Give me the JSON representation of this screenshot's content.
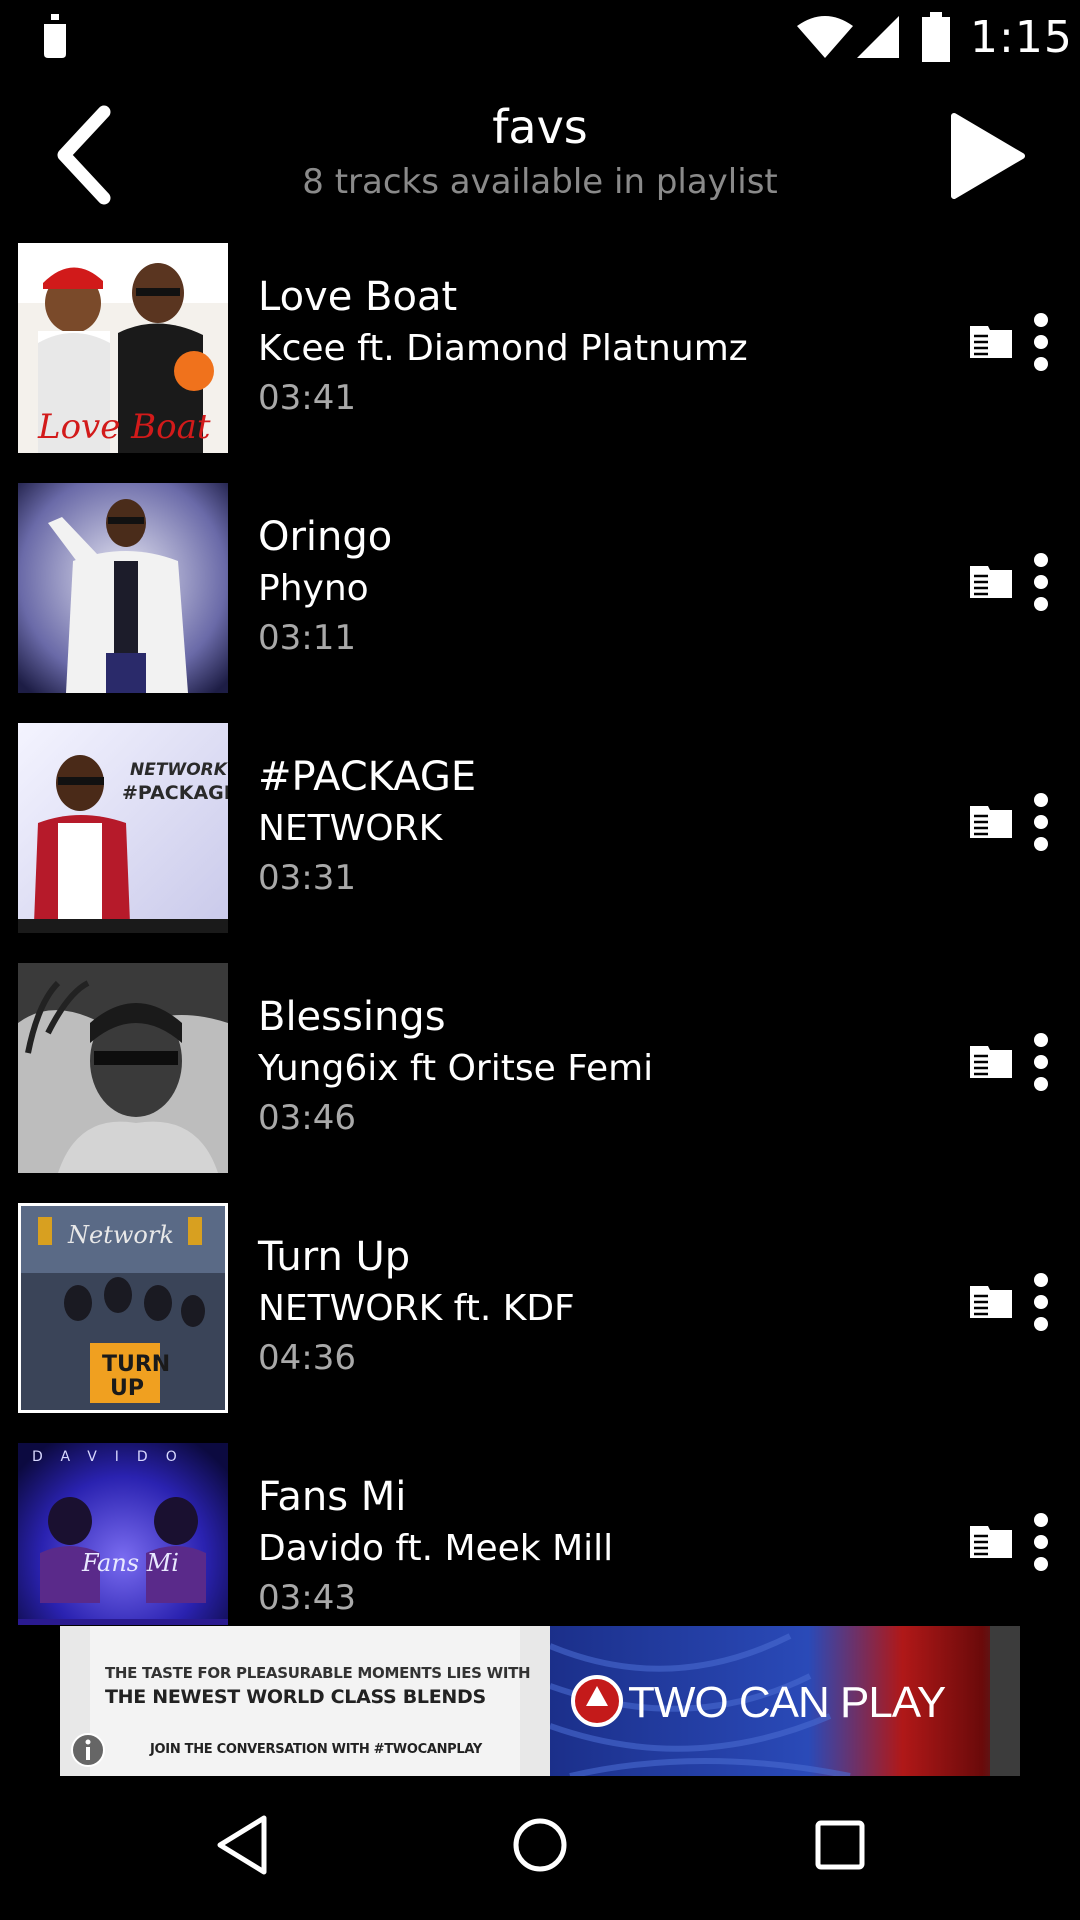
{
  "status_bar": {
    "time": "1:15",
    "icons": [
      "notification-icon",
      "wifi-icon",
      "signal-icon",
      "battery-icon"
    ]
  },
  "header": {
    "title": "favs",
    "subtitle": "8 tracks available in playlist",
    "back_icon": "chevron-left-icon",
    "play_icon": "play-icon"
  },
  "tracks": [
    {
      "title": "Love Boat",
      "artist": "Kcee ft. Diamond Platnumz",
      "duration": "03:41"
    },
    {
      "title": "Oringo",
      "artist": "Phyno",
      "duration": "03:11"
    },
    {
      "title": "#PACKAGE",
      "artist": "NETWORK",
      "duration": "03:31"
    },
    {
      "title": "Blessings",
      "artist": "Yung6ix ft Oritse Femi",
      "duration": "03:46"
    },
    {
      "title": "Turn Up",
      "artist": "NETWORK ft. KDF",
      "duration": "04:36"
    },
    {
      "title": "Fans Mi",
      "artist": "Davido ft. Meek Mill",
      "duration": "03:43"
    }
  ],
  "track_icons": {
    "queue": "queue-icon",
    "more": "more-vertical-icon"
  },
  "ad": {
    "line1": "THE TASTE FOR PLEASURABLE MOMENTS LIES WITH",
    "line2": "THE NEWEST WORLD CLASS BLENDS",
    "line3": "JOIN THE CONVERSATION WITH #TWOCANPLAY",
    "brand": "TWO CAN PLAY"
  },
  "nav_bar": {
    "icons": [
      "nav-back-icon",
      "nav-home-icon",
      "nav-recents-icon"
    ]
  },
  "colors": {
    "background": "#000000",
    "text_primary": "#ffffff",
    "text_secondary": "#8a8a8a",
    "text_duration": "#a9a9a9"
  }
}
